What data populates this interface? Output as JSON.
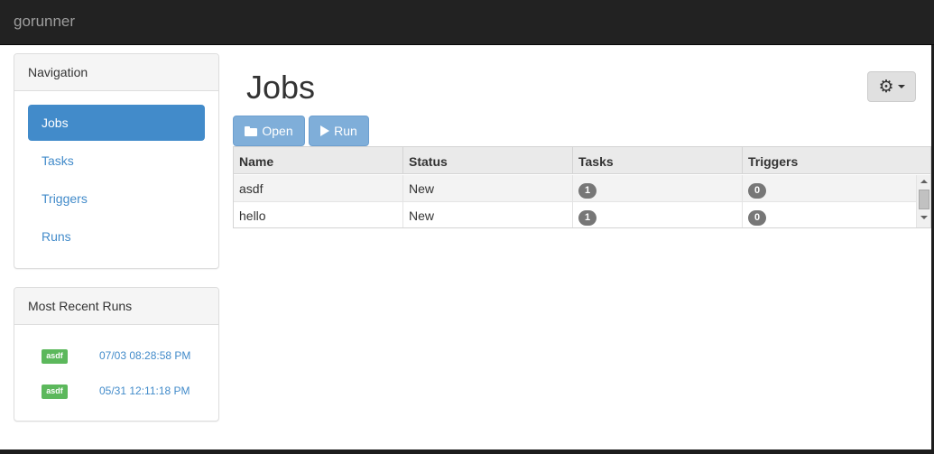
{
  "app": {
    "brand": "gorunner"
  },
  "navigation": {
    "heading": "Navigation",
    "items": [
      {
        "label": "Jobs",
        "active": true
      },
      {
        "label": "Tasks",
        "active": false
      },
      {
        "label": "Triggers",
        "active": false
      },
      {
        "label": "Runs",
        "active": false
      }
    ]
  },
  "recent_runs": {
    "heading": "Most Recent Runs",
    "runs": [
      {
        "job": "asdf",
        "time": "07/03 08:28:58 PM",
        "status_color": "#5cb85c"
      },
      {
        "job": "asdf",
        "time": "05/31 12:11:18 PM",
        "status_color": "#5cb85c"
      }
    ]
  },
  "main": {
    "title": "Jobs",
    "settings_icon": "gear-icon",
    "toolbar": {
      "open_label": "Open",
      "run_label": "Run"
    }
  },
  "jobs_table": {
    "columns": [
      "Name",
      "Status",
      "Tasks",
      "Triggers"
    ],
    "rows": [
      {
        "name": "asdf",
        "status": "New",
        "tasks": "1",
        "triggers": "0"
      },
      {
        "name": "hello",
        "status": "New",
        "tasks": "1",
        "triggers": "0"
      }
    ]
  },
  "colors": {
    "navbar": "#222222",
    "accent": "#428bca",
    "run_success": "#5cb85c",
    "badge": "#777777"
  }
}
